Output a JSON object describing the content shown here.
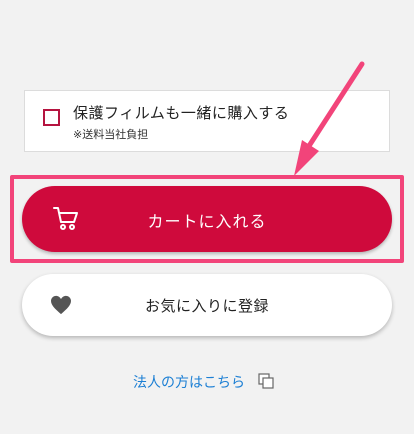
{
  "film_option": {
    "label": "保護フィルムも一緒に購入する",
    "note": "※送料当社負担",
    "checked": false
  },
  "cart_button": {
    "label": "カートに入れる",
    "icon": "cart-icon"
  },
  "favorite_button": {
    "label": "お気に入りに登録",
    "icon": "heart-icon"
  },
  "corporate_link": {
    "label": "法人の方はこちら",
    "icon": "copy-icon"
  },
  "colors": {
    "accent": "#cf0a3c",
    "highlight": "#f2447a",
    "link": "#1c7fd4"
  }
}
